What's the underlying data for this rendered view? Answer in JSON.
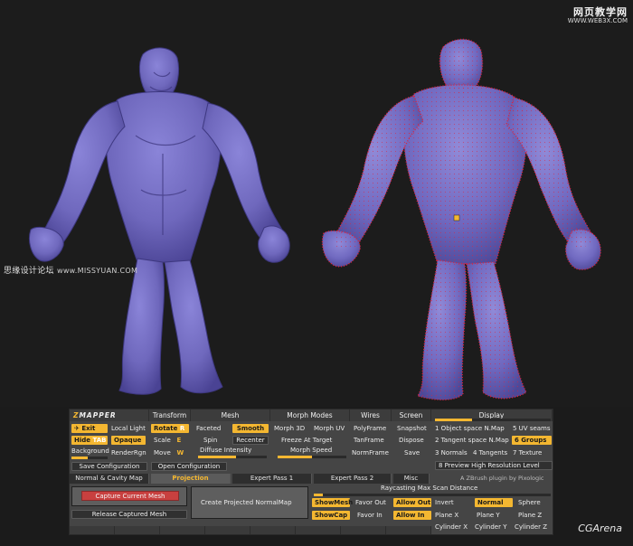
{
  "colors": {
    "accent": "#f4b731",
    "figure_fill": "#6f68bd",
    "figure_shade": "#4a4394",
    "normals": "#e0203a",
    "capture": "#c8403f",
    "panel": "#454545"
  },
  "watermarks": {
    "top_main": "网页教学网",
    "top_url": "WWW.WEB3X.COM",
    "left_cn": "思缘设计论坛",
    "left_url": "www.MISSYUAN.COM",
    "bottom_right": "CGArena"
  },
  "panel": {
    "logo_z": "Z",
    "logo_rest": "MAPPER",
    "headers": {
      "transform": "Transform",
      "mesh": "Mesh",
      "morph_modes": "Morph Modes",
      "wires": "Wires",
      "screen": "Screen",
      "display": "Display"
    },
    "col1": {
      "exit": "Exit",
      "local_light": "Local Light",
      "hide": "Hide",
      "tab": "TAB",
      "opaque": "Opaque",
      "background": "Background",
      "render_rgn": "RenderRgn",
      "save_config": "Save Configuration",
      "open_config": "Open Configuration"
    },
    "transform": {
      "rotate": "Rotate",
      "rotate_key": "R",
      "scale": "Scale",
      "scale_key": "E",
      "move": "Move",
      "move_key": "W"
    },
    "mesh": {
      "faceted": "Faceted",
      "smooth": "Smooth",
      "spin": "Spin",
      "recenter": "Recenter",
      "diffuse": "Diffuse Intensity"
    },
    "morph": {
      "morph_3d": "Morph 3D",
      "morph_uv": "Morph UV",
      "freeze": "Freeze At Target",
      "speed": "Morph Speed"
    },
    "wires": {
      "polyframe": "PolyFrame",
      "tanframe": "TanFrame",
      "normframe": "NormFrame"
    },
    "screen": {
      "snapshot": "Snapshot",
      "dispose": "Dispose",
      "save": "Save"
    },
    "display": {
      "o1": "1  Object space N.Map",
      "o2": "2  Tangent space N.Map",
      "o3": "3  Normals",
      "o4": "4  Tangents",
      "o5": "5  UV seams",
      "o6": "6  Groups",
      "o7": "7  Texture",
      "preview": "8  Preview High Resolution Level",
      "credit": "A ZBrush plugin by Pixologic"
    },
    "tabs": [
      "Normal & Cavity Map",
      "Projection",
      "Expert Pass 1",
      "Expert Pass 2",
      "Misc"
    ],
    "projection": {
      "capture": "Capture Current Mesh",
      "release": "Release Captured Mesh",
      "create": "Create Projected NormalMap",
      "raycast": "Raycasting Max Scan Distance",
      "show_mesh": "ShowMesh",
      "favor_out": "Favor Out",
      "allow_out": "Allow Out",
      "invert": "Invert",
      "normal": "Normal",
      "sphere": "Sphere",
      "show_cap": "ShowCap",
      "favor_in": "Favor In",
      "allow_in": "Allow In",
      "plane_x": "Plane X",
      "plane_y": "Plane Y",
      "plane_z": "Plane Z",
      "cyl_x": "Cylinder X",
      "cyl_y": "Cylinder Y",
      "cyl_z": "Cylinder Z"
    }
  }
}
